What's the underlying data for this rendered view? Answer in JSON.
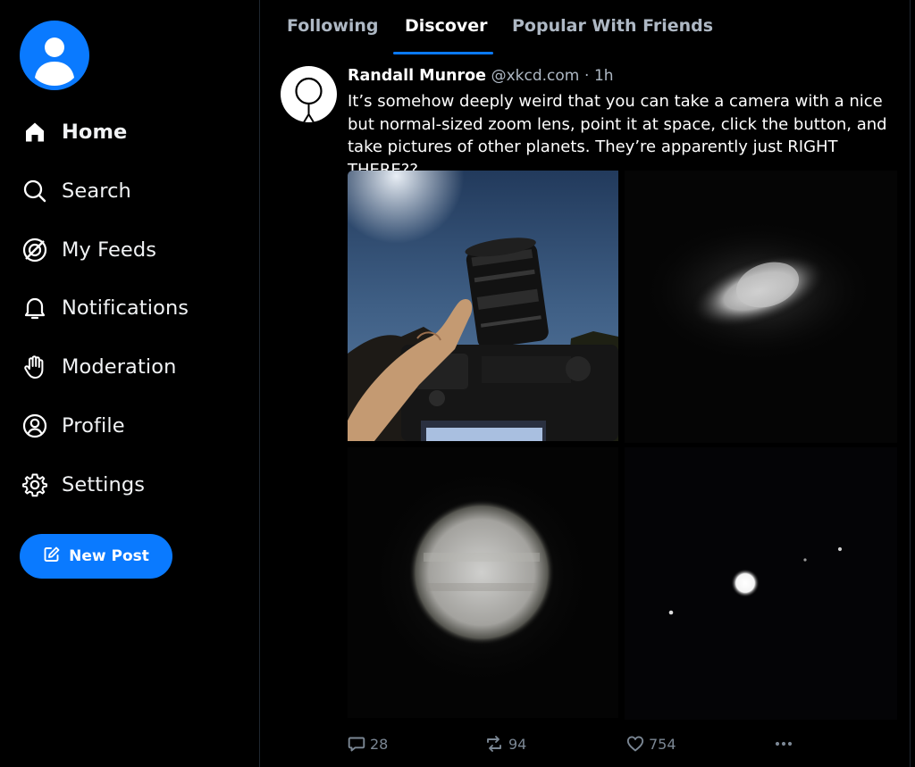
{
  "colors": {
    "accent": "#0a7aff",
    "background": "#000000",
    "muted_text": "#aeb8c4",
    "action_gray": "#7b8794"
  },
  "sidebar": {
    "avatar_icon": "user-avatar-icon",
    "items": [
      {
        "label": "Home",
        "icon": "home-icon",
        "active": true
      },
      {
        "label": "Search",
        "icon": "search-icon"
      },
      {
        "label": "My Feeds",
        "icon": "feeds-icon"
      },
      {
        "label": "Notifications",
        "icon": "bell-icon"
      },
      {
        "label": "Moderation",
        "icon": "hand-icon"
      },
      {
        "label": "Profile",
        "icon": "profile-icon"
      },
      {
        "label": "Settings",
        "icon": "gear-icon"
      }
    ],
    "new_post": {
      "label": "New Post",
      "icon": "compose-icon"
    }
  },
  "tabs": [
    {
      "label": "Following"
    },
    {
      "label": "Discover",
      "active": true
    },
    {
      "label": "Popular With Friends"
    }
  ],
  "post": {
    "author": "Randall Munroe",
    "handle": "@xkcd.com",
    "separator": "·",
    "time": "1h",
    "text": "It’s somehow deeply weird that you can take a camera with a nice but normal-sized zoom lens, point it at space, click the button, and take pictures of other planets. They’re apparently just RIGHT THERE??",
    "images": [
      {
        "icon": "camera-photo"
      },
      {
        "icon": "saturn-photo"
      },
      {
        "icon": "blurry-planet-photo"
      },
      {
        "icon": "jupiter-moons-photo"
      }
    ],
    "actions": {
      "replies": "28",
      "reposts": "94",
      "likes": "754",
      "more_icon": "more-dots-icon"
    }
  }
}
